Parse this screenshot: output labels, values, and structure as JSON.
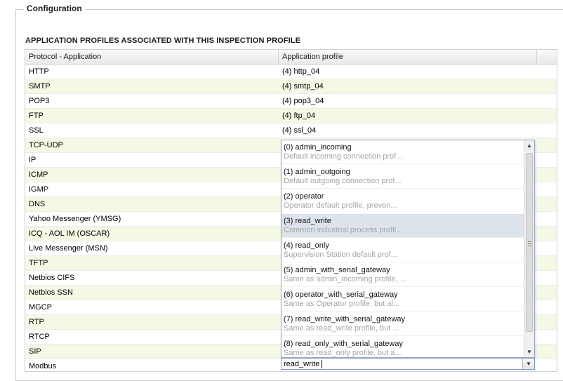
{
  "fieldset": {
    "legend": "Configuration"
  },
  "section": {
    "title": "APPLICATION PROFILES ASSOCIATED WITH THIS INSPECTION PROFILE"
  },
  "table": {
    "columns": [
      "Protocol - Application",
      "Application profile"
    ],
    "rows": [
      {
        "protocol": "HTTP",
        "profile": "(4) http_04"
      },
      {
        "protocol": "SMTP",
        "profile": "(4) smtp_04"
      },
      {
        "protocol": "POP3",
        "profile": "(4) pop3_04"
      },
      {
        "protocol": "FTP",
        "profile": "(4) ftp_04"
      },
      {
        "protocol": "SSL",
        "profile": "(4) ssl_04"
      },
      {
        "protocol": "TCP-UDP",
        "profile": ""
      },
      {
        "protocol": "IP",
        "profile": ""
      },
      {
        "protocol": "ICMP",
        "profile": ""
      },
      {
        "protocol": "IGMP",
        "profile": ""
      },
      {
        "protocol": "DNS",
        "profile": ""
      },
      {
        "protocol": "Yahoo Messenger (YMSG)",
        "profile": ""
      },
      {
        "protocol": "ICQ - AOL IM (OSCAR)",
        "profile": ""
      },
      {
        "protocol": "Live Messenger (MSN)",
        "profile": ""
      },
      {
        "protocol": "TFTP",
        "profile": ""
      },
      {
        "protocol": "Netbios CIFS",
        "profile": ""
      },
      {
        "protocol": "Netbios SSN",
        "profile": ""
      },
      {
        "protocol": "MGCP",
        "profile": ""
      },
      {
        "protocol": "RTP",
        "profile": ""
      },
      {
        "protocol": "RTCP",
        "profile": ""
      },
      {
        "protocol": "SIP",
        "profile": ""
      },
      {
        "protocol": "Modbus",
        "profile": ""
      }
    ]
  },
  "dropdown": {
    "options": [
      {
        "title": "(0) admin_incoming",
        "desc": "Default incoming connection prof..."
      },
      {
        "title": "(1) admin_outgoing",
        "desc": "Default outgoing connection prof..."
      },
      {
        "title": "(2) operator",
        "desc": "Operator default profile, preven..."
      },
      {
        "title": "(3) read_write",
        "desc": "Common industrial process profil...",
        "selected": true
      },
      {
        "title": "(4) read_only",
        "desc": "Supervision Station default prof..."
      },
      {
        "title": "(5) admin_with_serial_gateway",
        "desc": "Same as admin_incoming profile, ..."
      },
      {
        "title": "(6) operator_with_serial_gateway",
        "desc": "Same as Operator profile, but al..."
      },
      {
        "title": "(7) read_write_with_serial_gateway",
        "desc": "Same as read_write profile, but ..."
      },
      {
        "title": "(8) read_only_with_serial_gateway",
        "desc": "Same as read_only profile, but a..."
      }
    ],
    "scroll_up_icon": "triangle-up",
    "scroll_down_icon": "triangle-down"
  },
  "combo": {
    "value": "read_write",
    "toggle_icon": "chevron-down"
  }
}
